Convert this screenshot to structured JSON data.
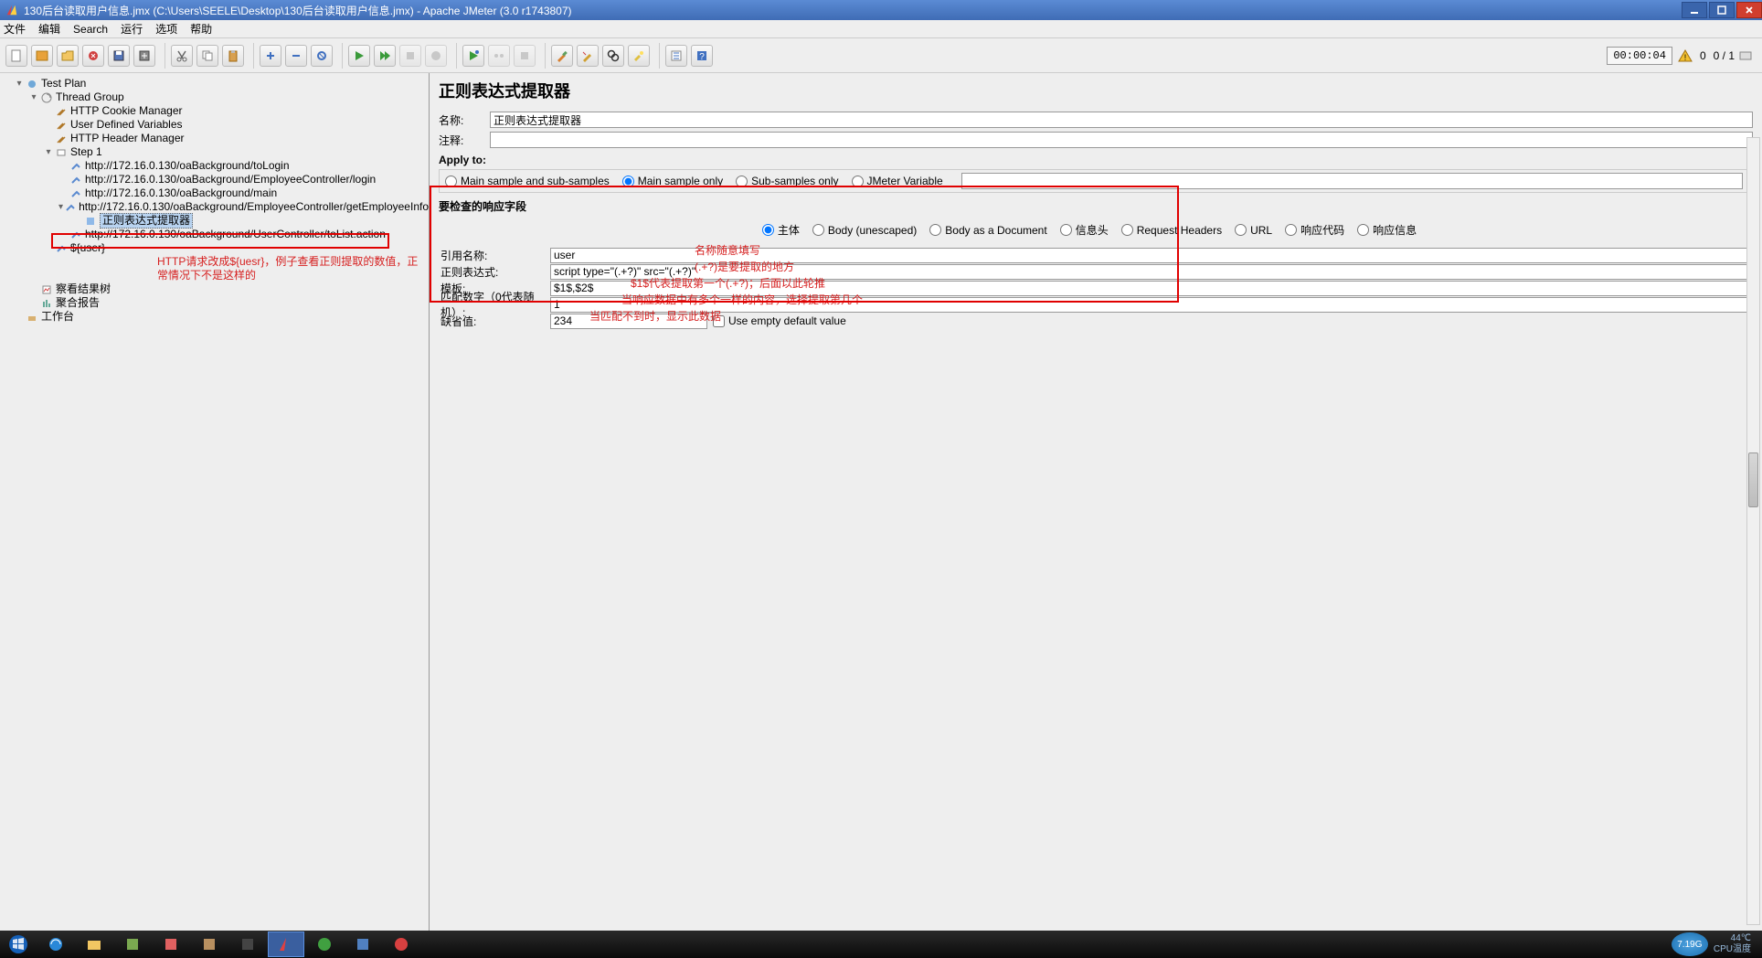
{
  "window": {
    "title": "130后台读取用户信息.jmx (C:\\Users\\SEELE\\Desktop\\130后台读取用户信息.jmx) - Apache JMeter (3.0 r1743807)"
  },
  "menu": {
    "file": "文件",
    "edit": "编辑",
    "search": "Search",
    "run": "运行",
    "options": "选项",
    "help": "帮助"
  },
  "toolbar": {
    "time": "00:00:04",
    "warn_count": "0",
    "thread_count": "0 / 1"
  },
  "tree": {
    "test_plan": "Test Plan",
    "thread_group": "Thread Group",
    "cookie_mgr": "HTTP Cookie Manager",
    "user_vars": "User Defined Variables",
    "header_mgr": "HTTP Header Manager",
    "step1": "Step 1",
    "req1": "http://172.16.0.130/oaBackground/toLogin",
    "req2": "http://172.16.0.130/oaBackground/EmployeeController/login",
    "req3": "http://172.16.0.130/oaBackground/main",
    "req4": "http://172.16.0.130/oaBackground/EmployeeController/getEmployeeInfo",
    "regex_ext": "正则表达式提取器",
    "req5": "http://172.16.0.130/oaBackground/UserController/toList.action",
    "user_var": "${user}",
    "view_tree": "察看结果树",
    "agg_report": "聚合报告",
    "workbench": "工作台",
    "annot_user": "HTTP请求改成${uesr}，例子查看正则提取的数值，正常情况下不是这样的"
  },
  "panel": {
    "title": "正则表达式提取器",
    "name_label": "名称:",
    "name_value": "正则表达式提取器",
    "comment_label": "注释:",
    "comment_value": "",
    "apply_to": "Apply to:",
    "apply_main_sub": "Main sample and sub-samples",
    "apply_main": "Main sample only",
    "apply_sub": "Sub-samples only",
    "apply_var": "JMeter Variable",
    "field_check": "要检查的响应字段",
    "rb_body": "主体",
    "rb_body_un": "Body (unescaped)",
    "rb_body_doc": "Body as a Document",
    "rb_headers": "信息头",
    "rb_req_headers": "Request Headers",
    "rb_url": "URL",
    "rb_code": "响应代码",
    "rb_msg": "响应信息",
    "ref_name_label": "引用名称:",
    "ref_name_value": "user",
    "hint_ref": "名称随意填写",
    "regex_label": "正则表达式:",
    "regex_value": "script type=\"(.+?)\" src=\"(.+?)\"",
    "hint_regex": "(.+?)是要提取的地方",
    "template_label": "模板:",
    "template_value": "$1$,$2$",
    "hint_template": "$1$代表提取第一个(.+?)；后面以此轮推",
    "match_label": "匹配数字（0代表随机）:",
    "match_value": "1",
    "hint_match": "当响应数据中有多个一样的内容，选择提取第几个",
    "default_label": "缺省值:",
    "default_value": "234",
    "hint_default": "当匹配不到时，显示此数据",
    "use_empty": "Use empty default value"
  },
  "taskbar": {
    "badge": "7.19G",
    "temp_c": "44℃",
    "temp_label": "CPU温度"
  }
}
